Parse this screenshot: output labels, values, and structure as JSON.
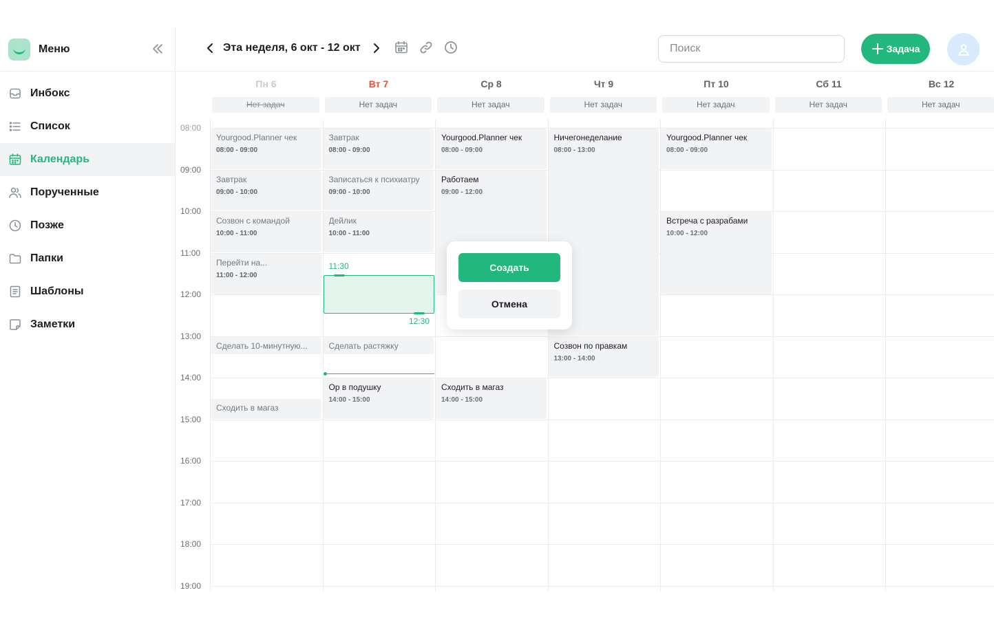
{
  "sidebar": {
    "title": "Меню",
    "items": [
      {
        "label": "Инбокс",
        "icon": "inbox-icon",
        "active": false
      },
      {
        "label": "Список",
        "icon": "list-icon",
        "active": false
      },
      {
        "label": "Календарь",
        "icon": "calendar-icon",
        "active": true
      },
      {
        "label": "Порученные",
        "icon": "users-icon",
        "active": false
      },
      {
        "label": "Позже",
        "icon": "clock-icon",
        "active": false
      },
      {
        "label": "Папки",
        "icon": "folder-icon",
        "active": false
      },
      {
        "label": "Шаблоны",
        "icon": "template-icon",
        "active": false
      },
      {
        "label": "Заметки",
        "icon": "note-icon",
        "active": false
      }
    ]
  },
  "header": {
    "week_title": "Эта неделя, 6 окт - 12 окт",
    "search_placeholder": "Поиск",
    "add_task_label": "Задача"
  },
  "calendar": {
    "days": [
      {
        "label": "Пн 6",
        "state": "past",
        "no_tasks": "Нет задач"
      },
      {
        "label": "Вт 7",
        "state": "today",
        "no_tasks": "Нет задач"
      },
      {
        "label": "Ср 8",
        "state": "future",
        "no_tasks": "Нет задач"
      },
      {
        "label": "Чт 9",
        "state": "future",
        "no_tasks": "Нет задач"
      },
      {
        "label": "Пт 10",
        "state": "future",
        "no_tasks": "Нет задач"
      },
      {
        "label": "Сб 11",
        "state": "future",
        "no_tasks": "Нет задач"
      },
      {
        "label": "Вс 12",
        "state": "future",
        "no_tasks": "Нет задач"
      }
    ],
    "hours": [
      "08:00",
      "09:00",
      "10:00",
      "11:00",
      "12:00",
      "13:00",
      "14:00",
      "15:00",
      "16:00",
      "17:00",
      "18:00",
      "19:00"
    ],
    "events": [
      {
        "day": 0,
        "start": 8,
        "end": 9,
        "title": "Yourgood.Planner чек",
        "time": "08:00 - 09:00",
        "past": true
      },
      {
        "day": 0,
        "start": 9,
        "end": 10,
        "title": "Завтрак",
        "time": "09:00 - 10:00",
        "past": true
      },
      {
        "day": 0,
        "start": 10,
        "end": 11,
        "title": "Созвон с командой",
        "time": "10:00 - 11:00",
        "past": true
      },
      {
        "day": 0,
        "start": 11,
        "end": 12,
        "title": "Перейти на...",
        "time": "11:00 - 12:00",
        "past": true
      },
      {
        "day": 0,
        "start": 13,
        "end": 13.45,
        "title": "Сделать 10-минутную...",
        "time": "",
        "past": true
      },
      {
        "day": 0,
        "start": 14.5,
        "end": 15,
        "title": "Сходить в магаз",
        "time": "",
        "past": true
      },
      {
        "day": 1,
        "start": 8,
        "end": 9,
        "title": "Завтрак",
        "time": "08:00 - 09:00",
        "past": true
      },
      {
        "day": 1,
        "start": 9,
        "end": 10,
        "title": "Записаться к психиатру",
        "time": "09:00 - 10:00",
        "past": true
      },
      {
        "day": 1,
        "start": 10,
        "end": 11,
        "title": "Дейлик",
        "time": "10:00 - 11:00",
        "past": true
      },
      {
        "day": 1,
        "start": 13,
        "end": 13.45,
        "title": "Сделать растяжку",
        "time": "",
        "past": true
      },
      {
        "day": 1,
        "start": 14,
        "end": 15,
        "title": "Ор в подушку",
        "time": "14:00 - 15:00",
        "past": false
      },
      {
        "day": 2,
        "start": 8,
        "end": 9,
        "title": "Yourgood.Planner чек",
        "time": "08:00 - 09:00",
        "past": false
      },
      {
        "day": 2,
        "start": 9,
        "end": 12,
        "title": "Работаем",
        "time": "09:00 - 12:00",
        "past": false
      },
      {
        "day": 2,
        "start": 14,
        "end": 15,
        "title": "Сходить в магаз",
        "time": "14:00 - 15:00",
        "past": false
      },
      {
        "day": 3,
        "start": 8,
        "end": 13,
        "title": "Ничегонеделание",
        "time": "08:00 - 13:00",
        "past": false
      },
      {
        "day": 3,
        "start": 13,
        "end": 14,
        "title": "Созвон по правкам",
        "time": "13:00 - 14:00",
        "past": false
      },
      {
        "day": 4,
        "start": 8,
        "end": 9,
        "title": "Yourgood.Planner чек",
        "time": "08:00 - 09:00",
        "past": false
      },
      {
        "day": 4,
        "start": 10,
        "end": 12,
        "title": "Встреча с разрабами",
        "time": "10:00 - 12:00",
        "past": false
      }
    ],
    "selection": {
      "day": 1,
      "start": 11.5,
      "end": 12.5,
      "start_label": "11:30",
      "end_label": "12:30"
    },
    "now": {
      "day": 1,
      "hour": 13.9
    },
    "popup": {
      "create_label": "Создать",
      "cancel_label": "Отмена"
    },
    "accent_color": "#22b87d",
    "today_color": "#e8513e"
  }
}
